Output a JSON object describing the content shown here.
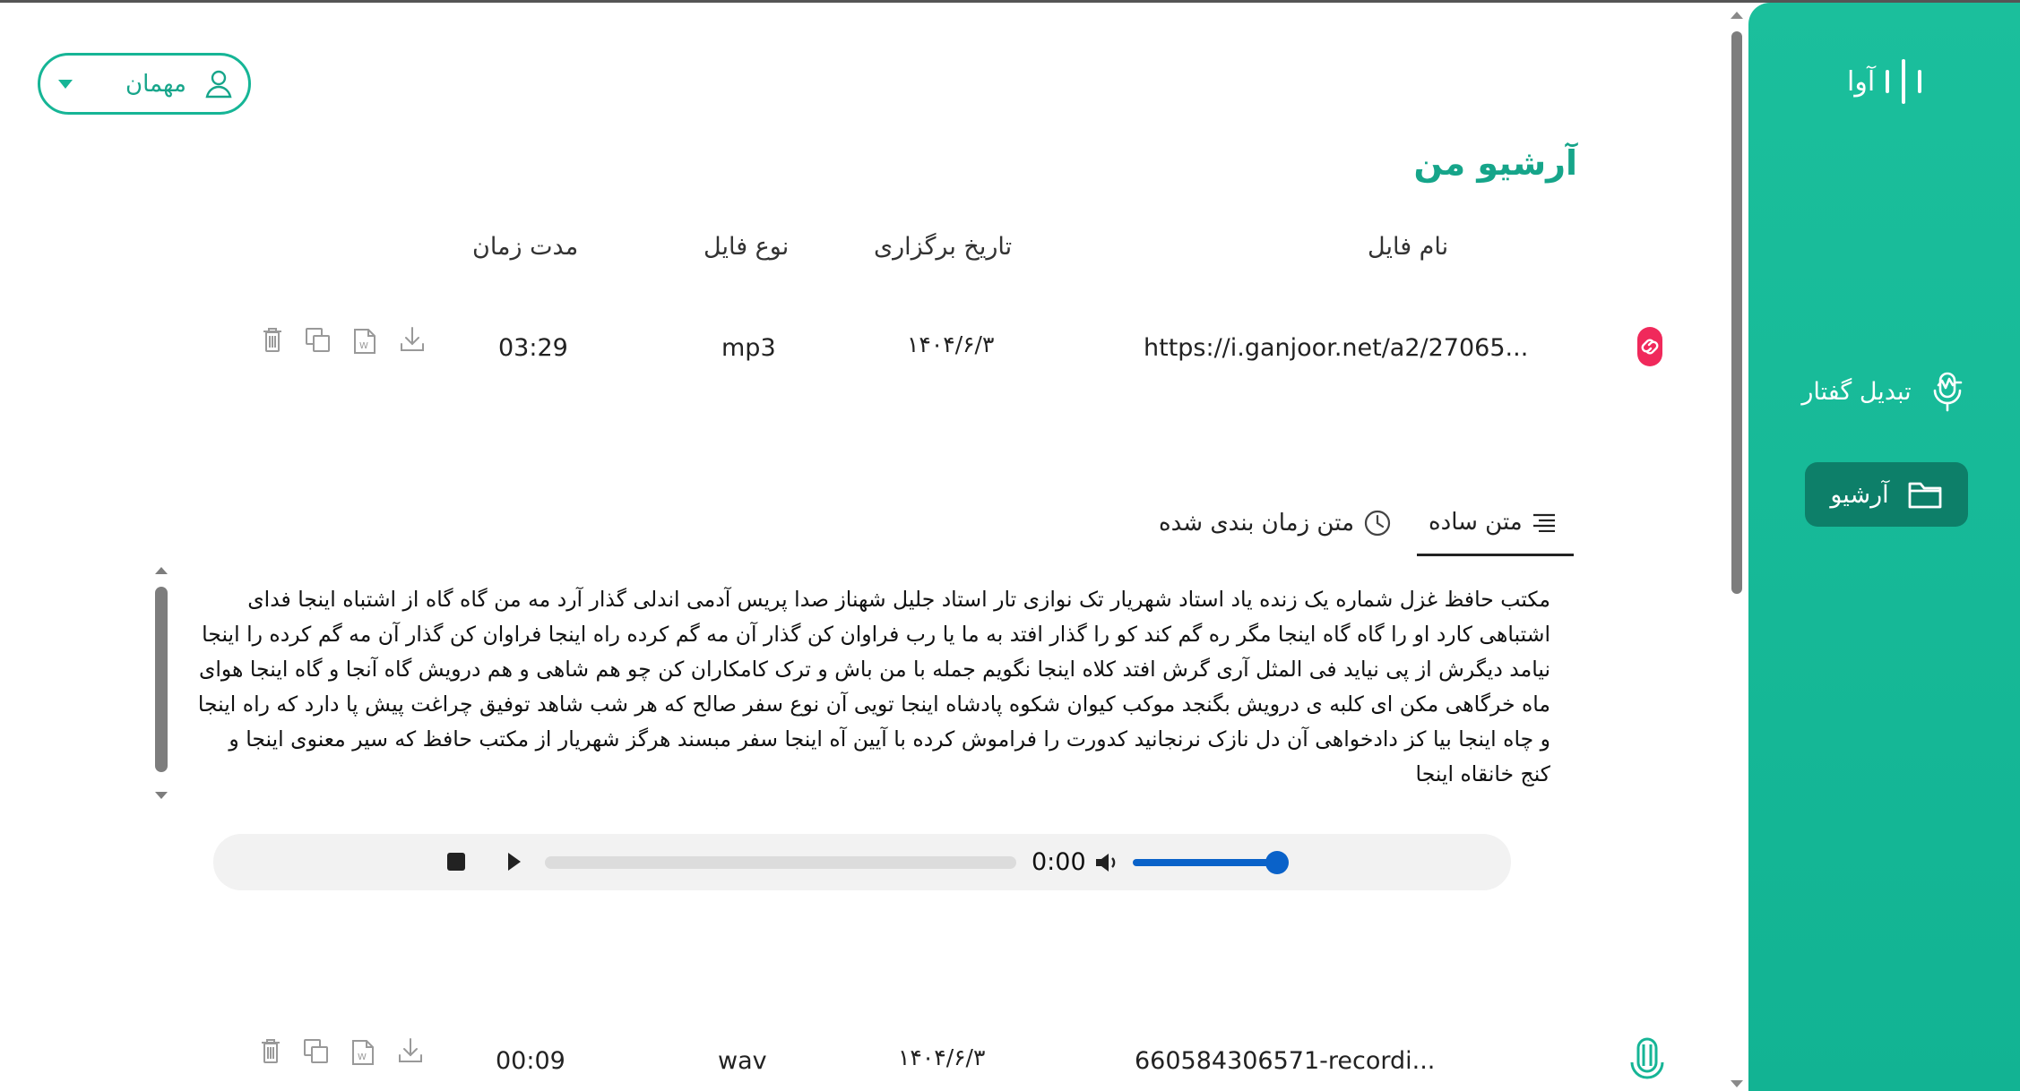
{
  "app": {
    "logo_text": "آوا",
    "accent": "#16b596"
  },
  "sidebar": {
    "items": [
      {
        "label": "تبدیل گفتار",
        "icon": "mic-wave-icon"
      },
      {
        "label": "آرشیو",
        "icon": "folder-icon",
        "active": true
      }
    ]
  },
  "user": {
    "label": "مهمان"
  },
  "page": {
    "title": "آرشیو من"
  },
  "table": {
    "headers": {
      "filename": "نام فایل",
      "date": "تاریخ برگزاری",
      "type": "نوع فایل",
      "duration": "مدت زمان"
    },
    "rows": [
      {
        "icon": "link-icon",
        "filename": "https://i.ganjoor.net/a2/27065...",
        "date": "۱۴۰۴/۶/۳",
        "type": "mp3",
        "duration": "03:29"
      },
      {
        "icon": "microphone-icon",
        "filename": "660584306571-recordi...",
        "date": "۱۴۰۴/۶/۳",
        "type": "wav",
        "duration": "00:09"
      }
    ]
  },
  "tabs": {
    "plain": "متن ساده",
    "timed": "متن زمان بندی شده"
  },
  "transcript": {
    "text": "مکتب حافظ غزل شماره یک زنده یاد استاد شهریار تک نوازی تار استاد جلیل شهناز صدا پریس آدمی اندلی گذار آرد مه من گاه گاه از اشتباه اینجا فدای اشتباهی کارد او را گاه گاه اینجا مگر ره گم کند کو را گذار افتد به ما یا رب فراوان کن گذار آن مه گم کرده راه اینجا فراوان کن گذار آن مه گم کرده را اینجا نیامد دیگرش از پی نیاید فی المثل آری گرش افتد کلاه اینجا نگویم جمله با من باش و ترک کامکاران کن چو هم شاهی و هم درویش گاه آنجا و گاه اینجا هوای ماه خرگاهی مکن ای کلبه ی درویش بگنجد موکب کیوان شکوه پادشاه اینجا تویی آن نوع سفر صالح که هر شب شاهد توفیق چراغت پیش پا دارد که راه اینجا و چاه اینجا بیا کز دادخواهی آن دل نازک نرنجانید کدورت را فراموش کرده با آیین آه اینجا سفر مبسند هرگز شهریار از مکتب حافظ که سیر معنوی اینجا و کنج خانقاه اینجا"
  },
  "player": {
    "time": "0:00",
    "progress": 0,
    "volume": 1
  }
}
